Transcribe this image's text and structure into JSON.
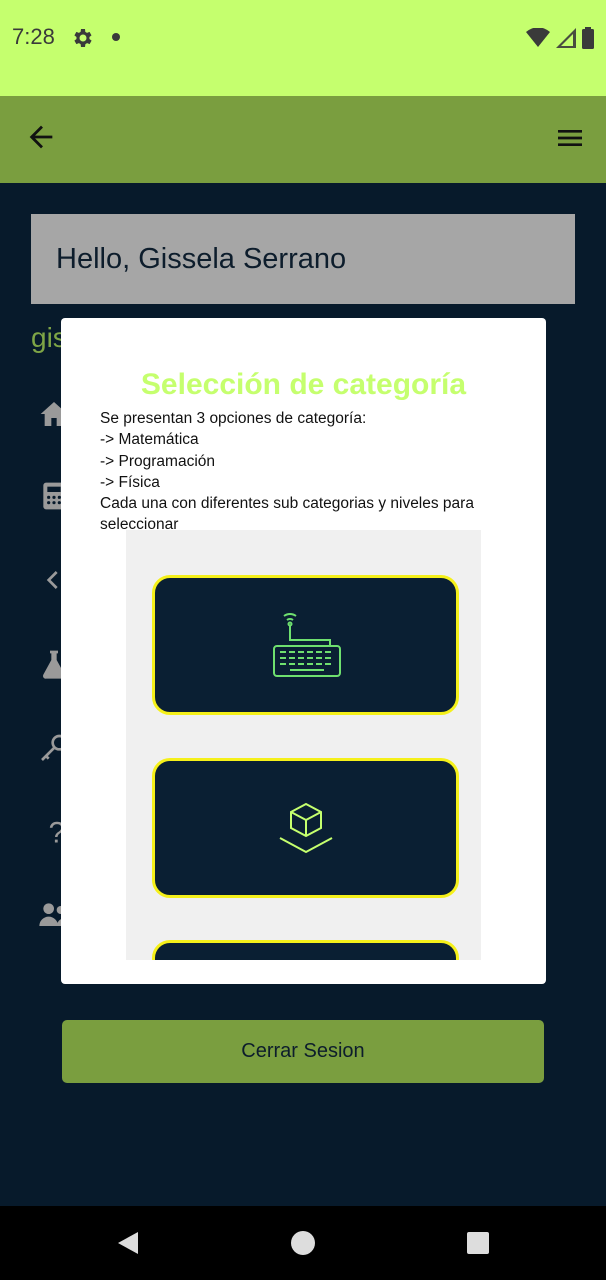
{
  "status_bar": {
    "time": "7:28",
    "icons": [
      "gear-icon",
      "notification-dot",
      "wifi-icon",
      "signal-icon",
      "battery-icon"
    ]
  },
  "app_bar": {
    "back_icon": "back-arrow-icon",
    "menu_icon": "menu-icon"
  },
  "header": {
    "greeting": "Hello, Gissela Serrano"
  },
  "sidebar": {
    "user_partial": "gis",
    "items": [
      "home-icon",
      "calculator-icon",
      "chevron-left-icon",
      "flask-icon",
      "key-icon",
      "question-icon",
      "users-icon"
    ]
  },
  "modal": {
    "title": "Selección de categoría",
    "description": "Se presentan 3 opciones de categoría:\n -> Matemática\n -> Programación\n -> Física\nCada una con diferentes sub categorias y niveles para seleccionar",
    "cards": [
      {
        "icon": "keyboard-icon"
      },
      {
        "icon": "cube-icon"
      },
      {
        "icon": ""
      }
    ]
  },
  "logout": {
    "label": "Cerrar Sesion"
  },
  "colors": {
    "status_bar": "#c5ff6e",
    "app_bar": "#7a9e3f",
    "background": "#071a2b",
    "title": "#c5ff6e",
    "card_border": "#f5f01a",
    "card_bg": "#0a1f33"
  }
}
